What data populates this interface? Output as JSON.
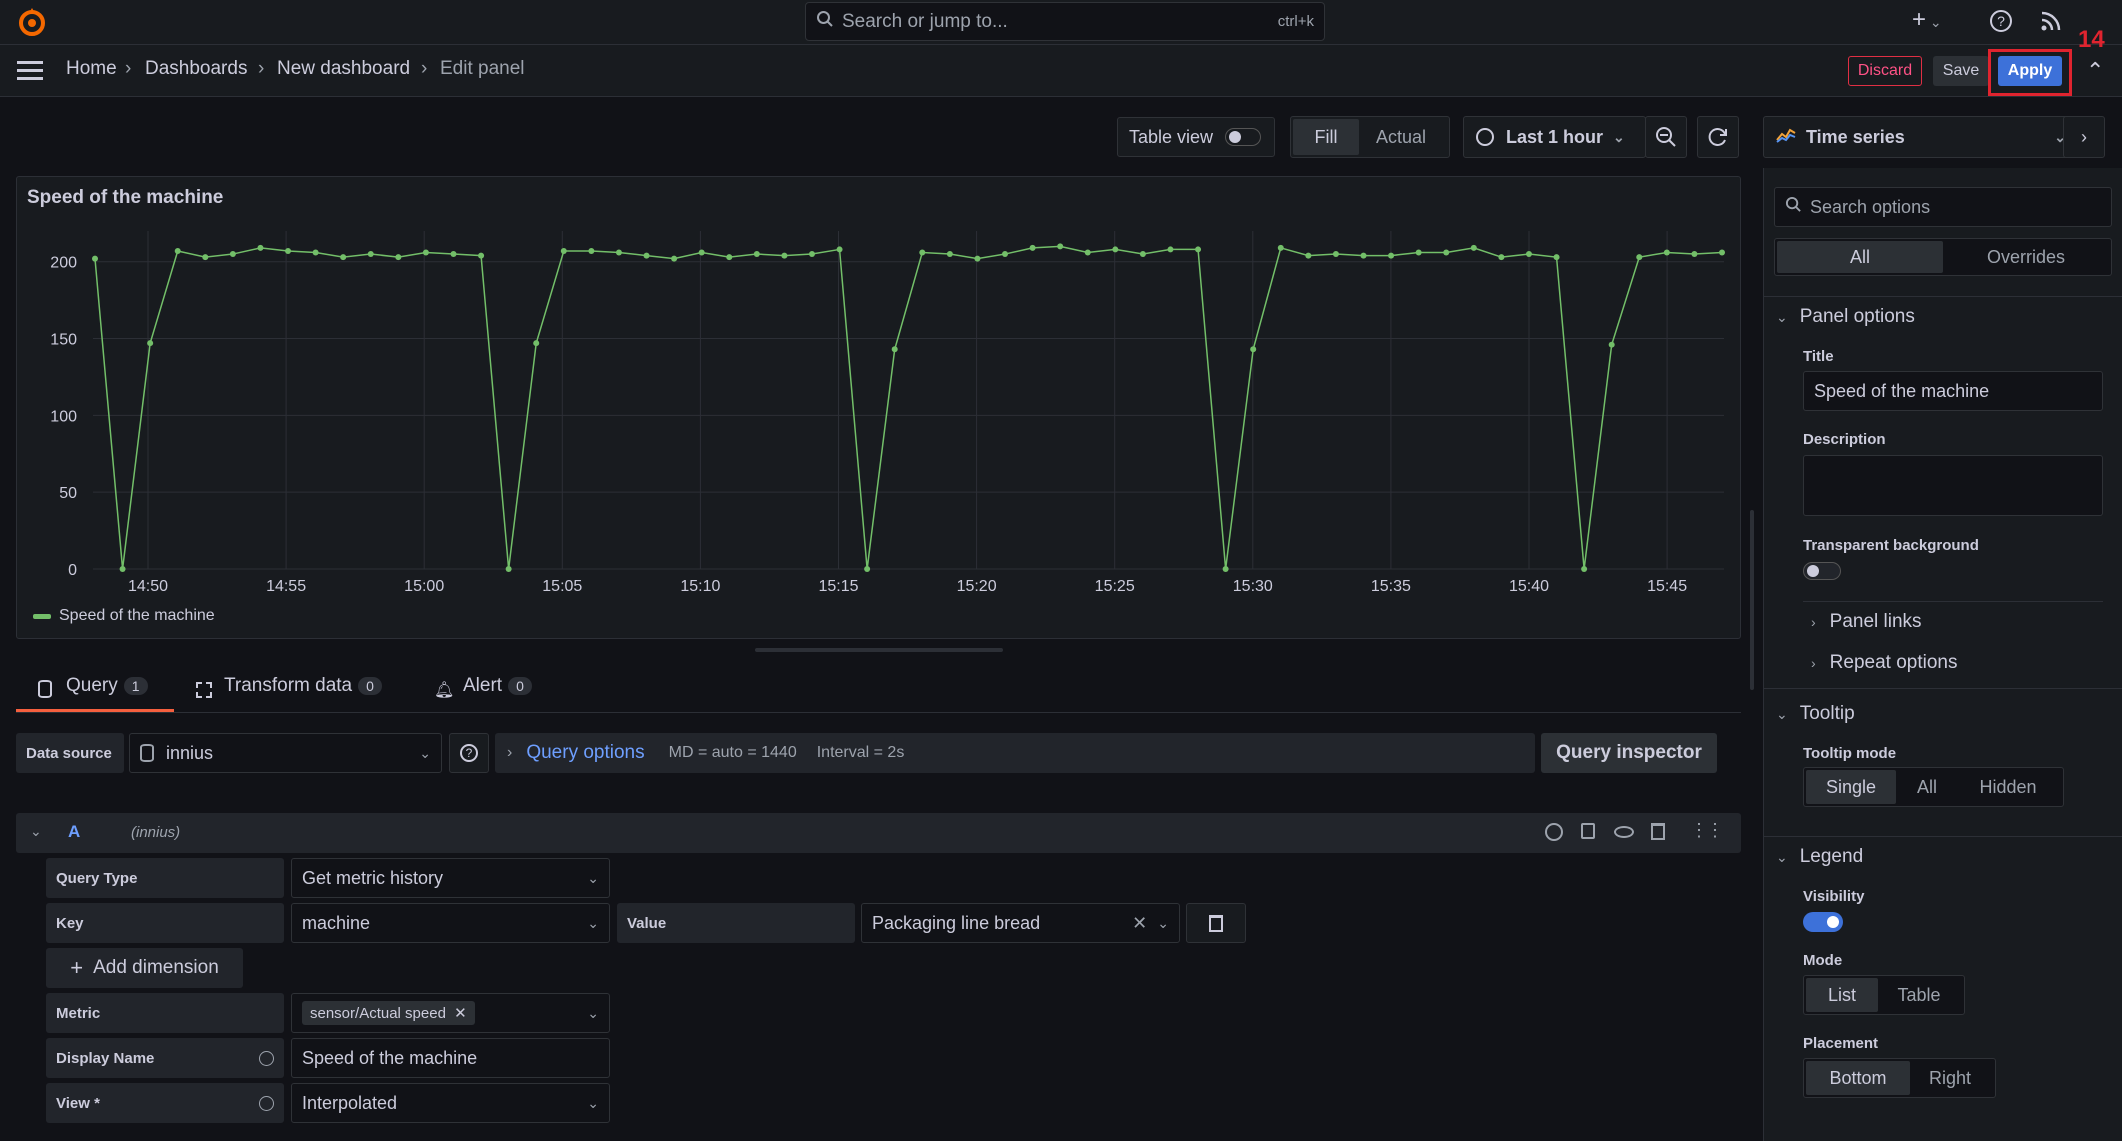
{
  "topbar": {
    "search_placeholder": "Search or jump to...",
    "search_shortcut": "ctrl+k",
    "add_label": "+"
  },
  "breadcrumb": {
    "home": "Home",
    "dashboards": "Dashboards",
    "new_dashboard": "New dashboard",
    "edit_panel": "Edit panel"
  },
  "actions": {
    "discard": "Discard",
    "save": "Save",
    "apply": "Apply",
    "annotation_number": "14"
  },
  "toolbar": {
    "table_view": "Table view",
    "fill": "Fill",
    "actual": "Actual",
    "time_range": "Last 1 hour"
  },
  "viz": {
    "type": "Time series"
  },
  "panel": {
    "title": "Speed of the machine",
    "legend": "Speed of the machine",
    "series_color": "#73bf69"
  },
  "chart_data": {
    "type": "line",
    "title": "Speed of the machine",
    "ylim": [
      0,
      220
    ],
    "yticks": [
      "0",
      "50",
      "100",
      "150",
      "200"
    ],
    "xticks": [
      "14:50",
      "14:55",
      "15:00",
      "15:05",
      "15:10",
      "15:15",
      "15:20",
      "15:25",
      "15:30",
      "15:35",
      "15:40",
      "15:45"
    ],
    "series": [
      {
        "name": "Speed of the machine",
        "color": "#73bf69",
        "values": [
          202,
          0,
          147,
          207,
          203,
          205,
          209,
          207,
          206,
          203,
          205,
          203,
          206,
          205,
          204,
          0,
          147,
          207,
          207,
          206,
          204,
          202,
          206,
          203,
          205,
          204,
          205,
          208,
          0,
          143,
          206,
          205,
          202,
          205,
          209,
          210,
          206,
          208,
          205,
          208,
          208,
          0,
          143,
          209,
          204,
          205,
          204,
          204,
          206,
          206,
          209,
          203,
          205,
          203,
          0,
          146,
          203,
          206,
          205,
          206
        ]
      }
    ]
  },
  "tabs": {
    "query": "Query",
    "query_count": "1",
    "transform": "Transform data",
    "transform_count": "0",
    "alert": "Alert",
    "alert_count": "0"
  },
  "datasource": {
    "label": "Data source",
    "value": "innius",
    "query_options": "Query options",
    "md": "MD = auto = 1440",
    "interval": "Interval = 2s",
    "inspector": "Query inspector"
  },
  "query": {
    "ref": "A",
    "ds": "(innius)",
    "query_type_label": "Query Type",
    "query_type_value": "Get metric history",
    "key_label": "Key",
    "key_value": "machine",
    "value_label": "Value",
    "value_value": "Packaging line bread",
    "add_dimension": "Add dimension",
    "metric_label": "Metric",
    "metric_value": "sensor/Actual speed",
    "display_name_label": "Display Name",
    "display_name_value": "Speed of the machine",
    "view_label": "View *",
    "view_value": "Interpolated"
  },
  "options": {
    "search_placeholder": "Search options",
    "all": "All",
    "overrides": "Overrides",
    "panel_options": "Panel options",
    "title_label": "Title",
    "title_value": "Speed of the machine",
    "description_label": "Description",
    "transparent_label": "Transparent background",
    "panel_links": "Panel links",
    "repeat_options": "Repeat options",
    "tooltip": "Tooltip",
    "tooltip_mode": "Tooltip mode",
    "single": "Single",
    "all_mode": "All",
    "hidden": "Hidden",
    "legend": "Legend",
    "visibility": "Visibility",
    "mode": "Mode",
    "list": "List",
    "table": "Table",
    "placement": "Placement",
    "bottom": "Bottom",
    "right": "Right"
  }
}
